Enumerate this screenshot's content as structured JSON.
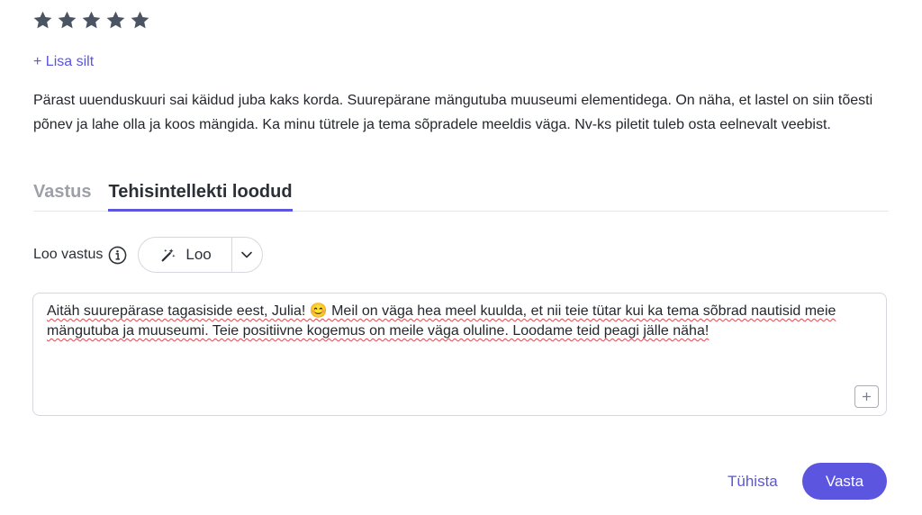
{
  "rating": {
    "value": 5,
    "max": 5,
    "star_color": "#4b5462"
  },
  "add_tag": {
    "label": "+ Lisa silt"
  },
  "review": {
    "text": "Pärast uuenduskuuri sai käidud juba kaks korda. Suurepärane mängutuba muuseumi elementidega. On näha, et lastel on siin tõesti põnev ja lahe olla ja koos mängida. Ka minu tütrele ja tema sõpradele meeldis väga. Nv-ks piletit tuleb osta eelnevalt veebist."
  },
  "tabs": [
    {
      "label": "Vastus",
      "active": false
    },
    {
      "label": "Tehisintellekti loodud",
      "active": true
    }
  ],
  "generate": {
    "label": "Loo vastus",
    "info_icon": "info-icon",
    "button_label": "Loo",
    "button_icon": "magic-wand-icon",
    "dropdown_icon": "chevron-down-icon"
  },
  "reply": {
    "text": "Aitäh suurepärase tagasiside eest, Julia! 😊 Meil on väga hea meel kuulda, et nii teie tütar kui ka tema sõbrad nautisid meie mängutuba ja muuseumi. Teie positiivne kogemus on meile väga oluline. Loodame teid peagi jälle näha!",
    "expand_icon": "plus-icon"
  },
  "actions": {
    "cancel_label": "Tühista",
    "submit_label": "Vasta"
  },
  "colors": {
    "accent": "#5b55e0",
    "border": "#d6d8de",
    "spellcheck": "#e0464f"
  }
}
